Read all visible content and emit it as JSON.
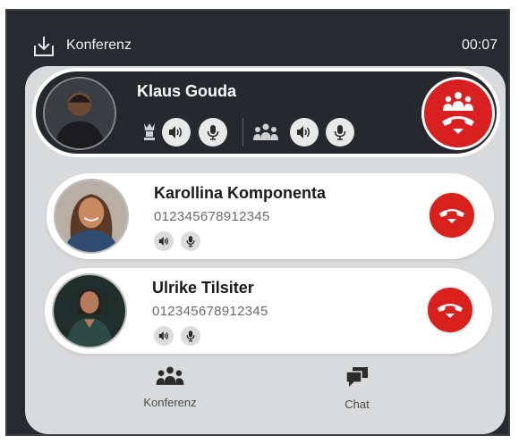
{
  "header": {
    "title": "Konferenz",
    "timer": "00:07",
    "download_icon": "download-icon"
  },
  "main_call": {
    "name": "Klaus Gouda",
    "avatar_icon": "avatar",
    "controls_left": [
      "crown-icon",
      "speaker-icon",
      "mic-icon"
    ],
    "controls_right": [
      "group-icon",
      "speaker-icon",
      "mic-icon"
    ],
    "hangup_icon": "end-conference-icon"
  },
  "participants": [
    {
      "name": "Karollina Komponenta",
      "number": "012345678912345"
    },
    {
      "name": "Ulrike Tilsiter",
      "number": "012345678912345"
    }
  ],
  "nav": [
    {
      "label": "Konferenz",
      "icon": "group-icon"
    },
    {
      "label": "Chat",
      "icon": "chat-icon"
    }
  ],
  "colors": {
    "window_bg": "#272a2e",
    "panel_bg": "#d9dadc",
    "hangup_red": "#d92020"
  }
}
